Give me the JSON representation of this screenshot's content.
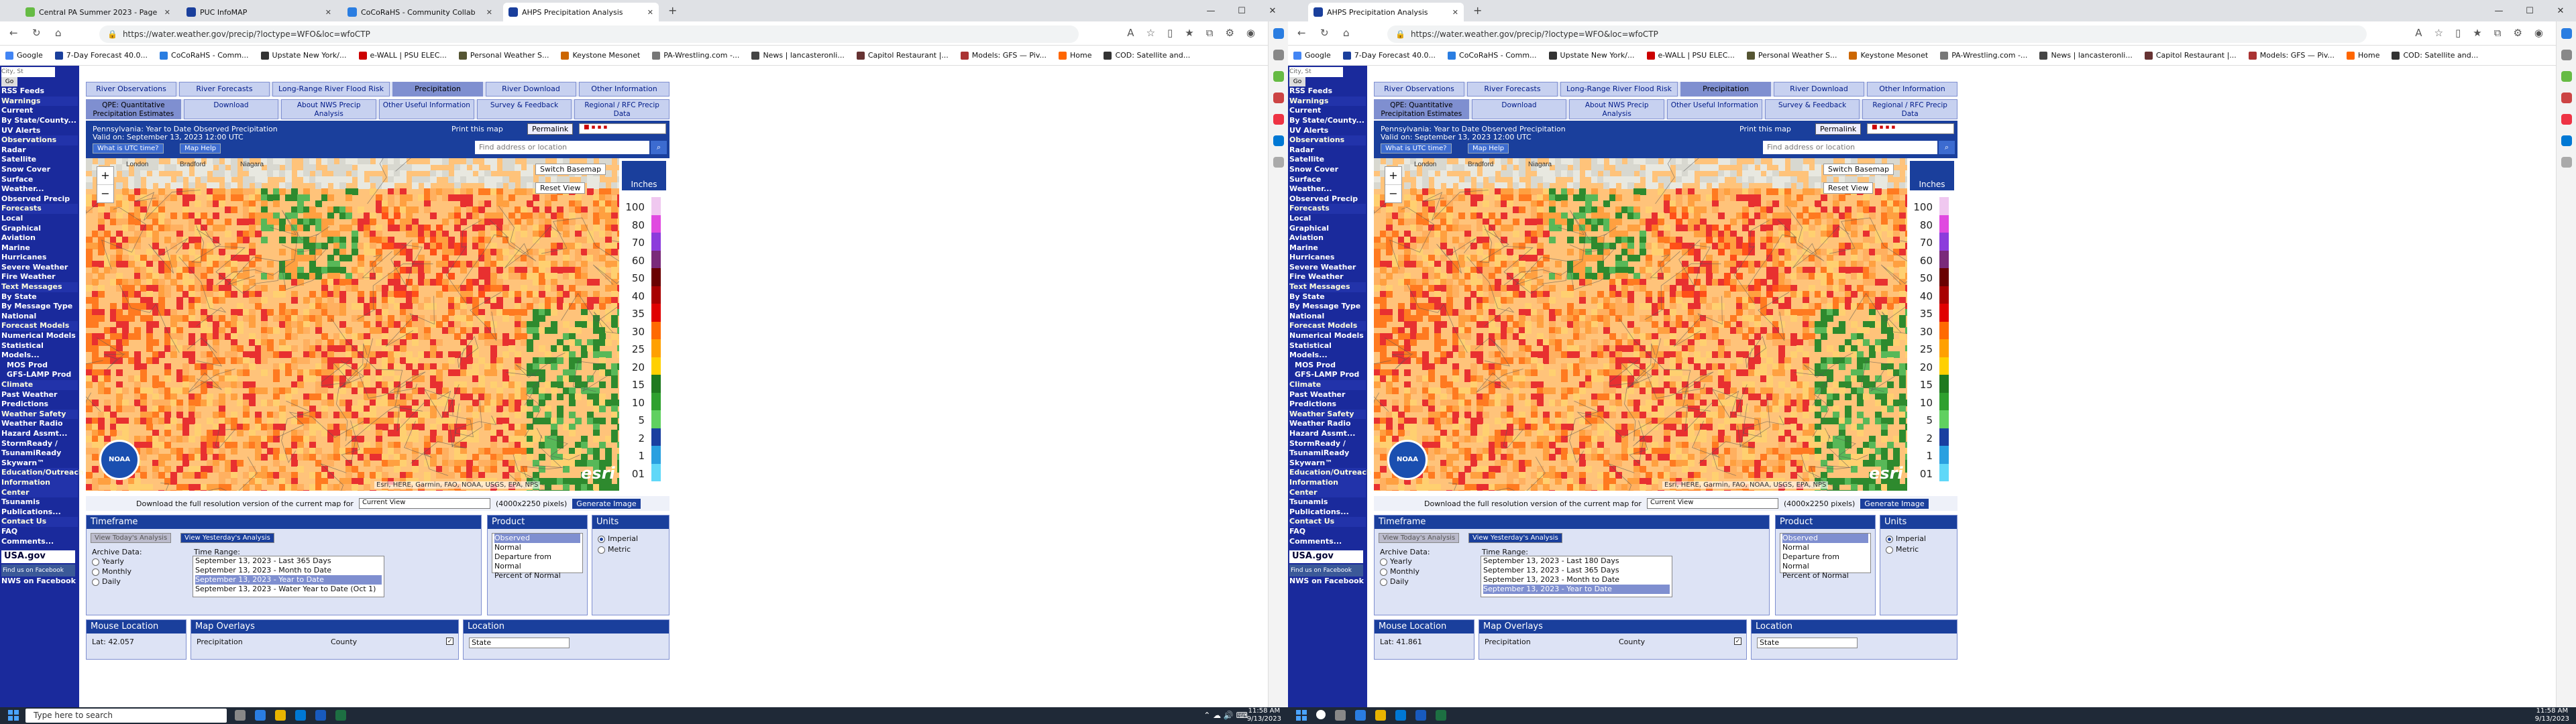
{
  "browser_left": {
    "tabs": [
      {
        "label": "Central PA Summer 2023 - Page",
        "color": "#6b4"
      },
      {
        "label": "PUC InfoMAP",
        "color": "#1a3f9c"
      },
      {
        "label": "CoCoRaHS - Community Collab",
        "color": "#2a7de1"
      },
      {
        "label": "AHPS Precipitation Analysis",
        "color": "#1a3f9c"
      }
    ],
    "active_tab": 3
  },
  "browser_right": {
    "tabs": [
      {
        "label": "AHPS Precipitation Analysis",
        "color": "#1a3f9c"
      }
    ],
    "active_tab": 0
  },
  "url": "https://water.weather.gov/precip/?loctype=WFO&loc=wfoCTP",
  "bookmarks": [
    {
      "label": "Google",
      "color": "#4285f4"
    },
    {
      "label": "7-Day Forecast 40.0...",
      "color": "#1a3f9c"
    },
    {
      "label": "CoCoRaHS - Comm...",
      "color": "#2a7de1"
    },
    {
      "label": "Upstate New York/...",
      "color": "#333"
    },
    {
      "label": "e-WALL | PSU ELEC...",
      "color": "#c00"
    },
    {
      "label": "Personal Weather S...",
      "color": "#553"
    },
    {
      "label": "Keystone Mesonet",
      "color": "#c60"
    },
    {
      "label": "PA-Wrestling.com -...",
      "color": "#777"
    },
    {
      "label": "News | lancasteronli...",
      "color": "#444"
    },
    {
      "label": "Capitol Restaurant |...",
      "color": "#633"
    },
    {
      "label": "Models: GFS — Piv...",
      "color": "#a33"
    },
    {
      "label": "Home",
      "color": "#f60"
    },
    {
      "label": "COD: Satellite and...",
      "color": "#333"
    }
  ],
  "leftnav": [
    {
      "t": "City, St",
      "c": ""
    },
    {
      "t": "Go",
      "c": ""
    },
    {
      "t": "RSS Feeds",
      "c": "b"
    },
    {
      "t": "Warnings",
      "c": "h"
    },
    {
      "t": "Current",
      "c": "b"
    },
    {
      "t": "By State/County...",
      "c": "b"
    },
    {
      "t": "UV Alerts",
      "c": "b"
    },
    {
      "t": "Observations",
      "c": "h"
    },
    {
      "t": "Radar",
      "c": "b"
    },
    {
      "t": "Satellite",
      "c": "b"
    },
    {
      "t": "Snow Cover",
      "c": "b"
    },
    {
      "t": "Surface Weather...",
      "c": "b"
    },
    {
      "t": "Observed Precip",
      "c": "b"
    },
    {
      "t": "Forecasts",
      "c": "h"
    },
    {
      "t": "Local",
      "c": "b"
    },
    {
      "t": "Graphical",
      "c": "b"
    },
    {
      "t": "Aviation",
      "c": "b"
    },
    {
      "t": "Marine",
      "c": "b"
    },
    {
      "t": "Hurricanes",
      "c": "b"
    },
    {
      "t": "Severe Weather",
      "c": "b"
    },
    {
      "t": "Fire Weather",
      "c": "b"
    },
    {
      "t": "Text Messages",
      "c": "h"
    },
    {
      "t": "By State",
      "c": "b"
    },
    {
      "t": "By Message Type",
      "c": "b"
    },
    {
      "t": "National",
      "c": "b"
    },
    {
      "t": "Forecast Models",
      "c": "h"
    },
    {
      "t": "Numerical Models",
      "c": "b"
    },
    {
      "t": "Statistical Models...",
      "c": "b"
    },
    {
      "t": "MOS Prod",
      "c": "sub"
    },
    {
      "t": "GFS-LAMP Prod",
      "c": "sub"
    },
    {
      "t": "Climate",
      "c": "h"
    },
    {
      "t": "Past Weather",
      "c": "b"
    },
    {
      "t": "Predictions",
      "c": "b"
    },
    {
      "t": "Weather Safety",
      "c": "h"
    },
    {
      "t": "Weather Radio",
      "c": "b"
    },
    {
      "t": "Hazard Assmt...",
      "c": "b"
    },
    {
      "t": "StormReady / TsunamiReady",
      "c": "b"
    },
    {
      "t": "Skywarn™",
      "c": "b"
    },
    {
      "t": "Education/Outreach",
      "c": "h"
    },
    {
      "t": "Information Center",
      "c": "h"
    },
    {
      "t": "Tsunamis",
      "c": "b"
    },
    {
      "t": "Publications...",
      "c": "b"
    },
    {
      "t": "Contact Us",
      "c": "h"
    },
    {
      "t": "FAQ",
      "c": "b"
    },
    {
      "t": "Comments...",
      "c": "b"
    }
  ],
  "usa_gov": "USA.gov",
  "facebook": "Find us on Facebook",
  "nws_facebook": "NWS on Facebook",
  "tabs_top": [
    "River Observations",
    "River Forecasts",
    "Long-Range River Flood Risk",
    "Precipitation",
    "River Download",
    "Other Information"
  ],
  "tabs_top_selected": 3,
  "tabs_sub": [
    "QPE: Quantitative Precipitation Estimates",
    "Download",
    "About NWS Precip Analysis",
    "Other Useful Information",
    "Survey & Feedback",
    "Regional / RFC Precip Data"
  ],
  "tabs_sub_selected": 0,
  "map_title": "Pennsylvania: Year to Date Observed Precipitation",
  "map_valid": "Valid on: September 13, 2023 12:00 UTC",
  "btn_utc": "What is UTC time?",
  "btn_help": "Map Help",
  "print": "Print this map",
  "permalink": "Permalink",
  "find_placeholder": "Find address or location",
  "switch_basemap": "Switch Basemap",
  "reset_view": "Reset View",
  "legend_unit": "Inches",
  "legend": [
    {
      "v": "100",
      "c": "#f0c8f0"
    },
    {
      "v": "80",
      "c": "#e04ae0"
    },
    {
      "v": "70",
      "c": "#8c3cdc"
    },
    {
      "v": "60",
      "c": "#7a2a7a"
    },
    {
      "v": "50",
      "c": "#6a0000"
    },
    {
      "v": "40",
      "c": "#a80000"
    },
    {
      "v": "35",
      "c": "#e00000"
    },
    {
      "v": "30",
      "c": "#ff6a00"
    },
    {
      "v": "25",
      "c": "#ffa000"
    },
    {
      "v": "20",
      "c": "#ffd000"
    },
    {
      "v": "15",
      "c": "#1f7a1f"
    },
    {
      "v": "10",
      "c": "#2ea02e"
    },
    {
      "v": "5",
      "c": "#60d060"
    },
    {
      "v": "2",
      "c": "#1a3fa0"
    },
    {
      "v": "1",
      "c": "#2aa0e0"
    },
    {
      "v": "01",
      "c": "#60d8f8"
    }
  ],
  "attribution": "Esri, HERE, Garmin, FAO, NOAA, USGS, EPA, NPS",
  "esri": "esri",
  "noaa": "NOAA",
  "map_places": [
    "London",
    "Bradford",
    "Niagara"
  ],
  "download_text": "Download the full resolution version of the current map for",
  "download_select": "Current View",
  "download_size": "(4000x2250 pixels)",
  "generate": "Generate Image",
  "timeframe": {
    "title": "Timeframe",
    "btn_today": "View Today's Analysis",
    "btn_yesterday": "View Yesterday's Analysis",
    "archive_label": "Archive Data:",
    "archive": [
      "Yearly",
      "Monthly",
      "Daily"
    ],
    "range_label": "Time Range:",
    "ranges_left": [
      "September 13, 2023 - Last 365 Days",
      "September 13, 2023 - Month to Date",
      "September 13, 2023 - Year to Date",
      "September 13, 2023 - Water Year to Date (Oct 1)"
    ],
    "ranges_right": [
      "September 13, 2023 - Last 180 Days",
      "September 13, 2023 - Last 365 Days",
      "September 13, 2023 - Month to Date",
      "September 13, 2023 - Year to Date"
    ]
  },
  "product": {
    "title": "Product",
    "items": [
      "Observed",
      "Normal",
      "Departure from Normal",
      "Percent of Normal"
    ],
    "selected": 0
  },
  "units": {
    "title": "Units",
    "items": [
      "Imperial",
      "Metric"
    ],
    "selected": 0
  },
  "mouse": {
    "title": "Mouse Location",
    "lat_left": "Lat: 42.057",
    "lat_right": "Lat: 41.861"
  },
  "overlays": {
    "title": "Map Overlays",
    "items": [
      "Precipitation",
      "County"
    ]
  },
  "location": {
    "title": "Location",
    "select": "State"
  },
  "taskbar": {
    "search": "Type here to search",
    "time": "11:58 AM",
    "date": "9/13/2023"
  }
}
